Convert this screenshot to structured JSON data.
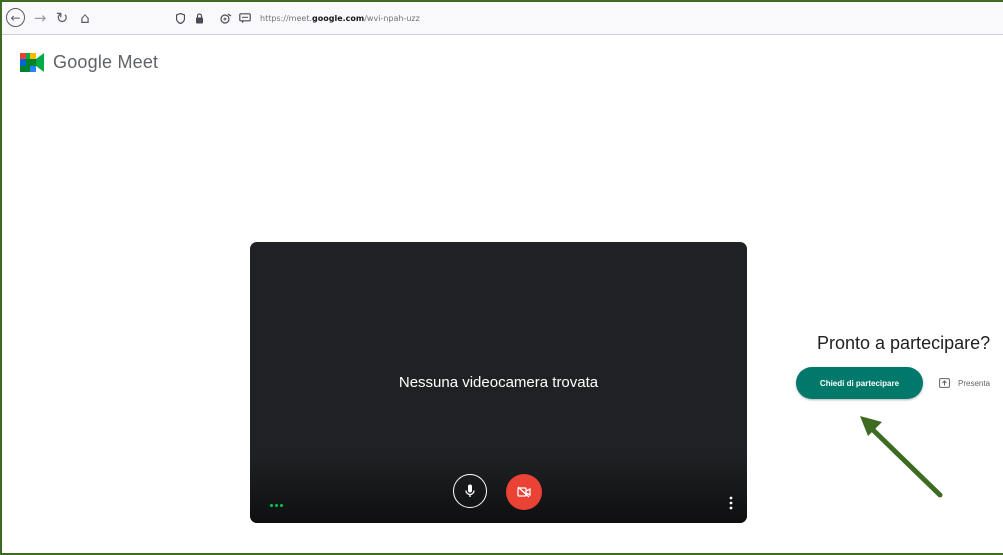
{
  "browser": {
    "url_prefix": "https://meet.",
    "url_domain": "google.com",
    "url_path": "/wvi-npah-uzz",
    "icons": [
      "back-icon",
      "forward-icon",
      "reload-icon",
      "home-icon",
      "shield-icon",
      "lock-icon",
      "permissions-icon",
      "chat-icon"
    ]
  },
  "app": {
    "name": "Google Meet",
    "logo_colors": [
      "#00832d",
      "#0066da",
      "#e94235",
      "#2684fc",
      "#00ac47",
      "#ffba00"
    ]
  },
  "preview": {
    "message": "Nessuna videocamera trovata",
    "mic_state": "on",
    "camera_state": "off",
    "camera_button_color": "#ea4335"
  },
  "join": {
    "heading": "Pronto a partecipare?",
    "ask_label": "Chiedi di partecipare",
    "ask_color": "#00796b",
    "present_label": "Presenta"
  },
  "annotation": {
    "arrow_color": "#3d6b21"
  }
}
